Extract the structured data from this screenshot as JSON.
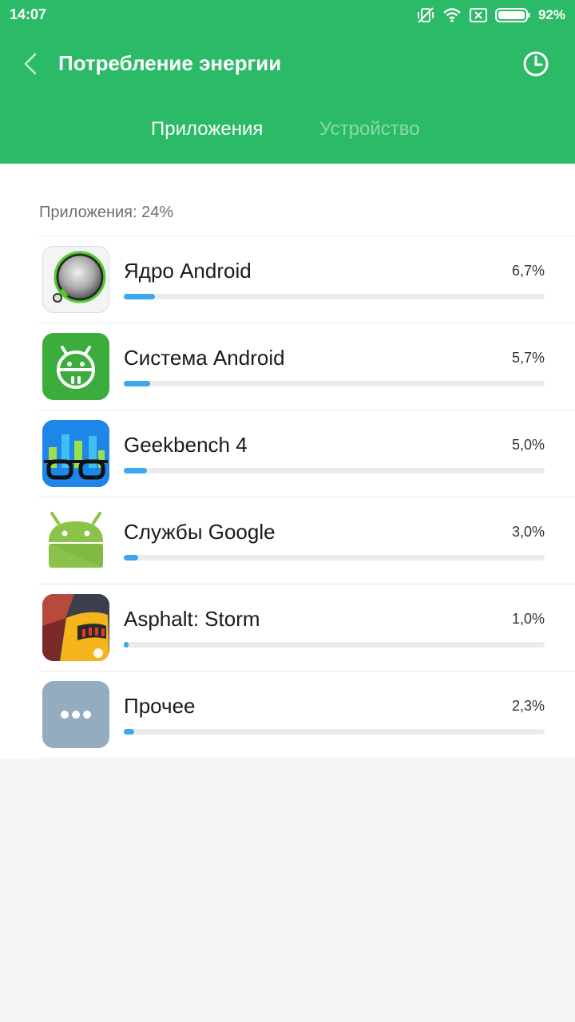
{
  "status": {
    "time": "14:07",
    "battery": "92%"
  },
  "header": {
    "title": "Потребление энергии"
  },
  "tabs": [
    {
      "label": "Приложения",
      "active": true
    },
    {
      "label": "Устройство",
      "active": false
    }
  ],
  "section": {
    "title": "Приложения: 24%"
  },
  "apps": [
    {
      "name": "Ядро Android",
      "percent": "6,7%",
      "level": 0.067,
      "icon": "android-kernel-icon"
    },
    {
      "name": "Система Android",
      "percent": "5,7%",
      "level": 0.057,
      "icon": "android-system-icon"
    },
    {
      "name": "Geekbench 4",
      "percent": "5,0%",
      "level": 0.05,
      "icon": "geekbench-icon"
    },
    {
      "name": "Службы Google",
      "percent": "3,0%",
      "level": 0.03,
      "icon": "android-robot-icon"
    },
    {
      "name": "Asphalt: Storm",
      "percent": "1,0%",
      "level": 0.01,
      "icon": "asphalt-game-icon"
    },
    {
      "name": "Прочее",
      "percent": "2,3%",
      "level": 0.023,
      "icon": "more-dots-icon"
    }
  ],
  "colors": {
    "header": "#2bbb68",
    "bar_fill": "#3aa7ee",
    "bar_track": "#ebebeb"
  }
}
